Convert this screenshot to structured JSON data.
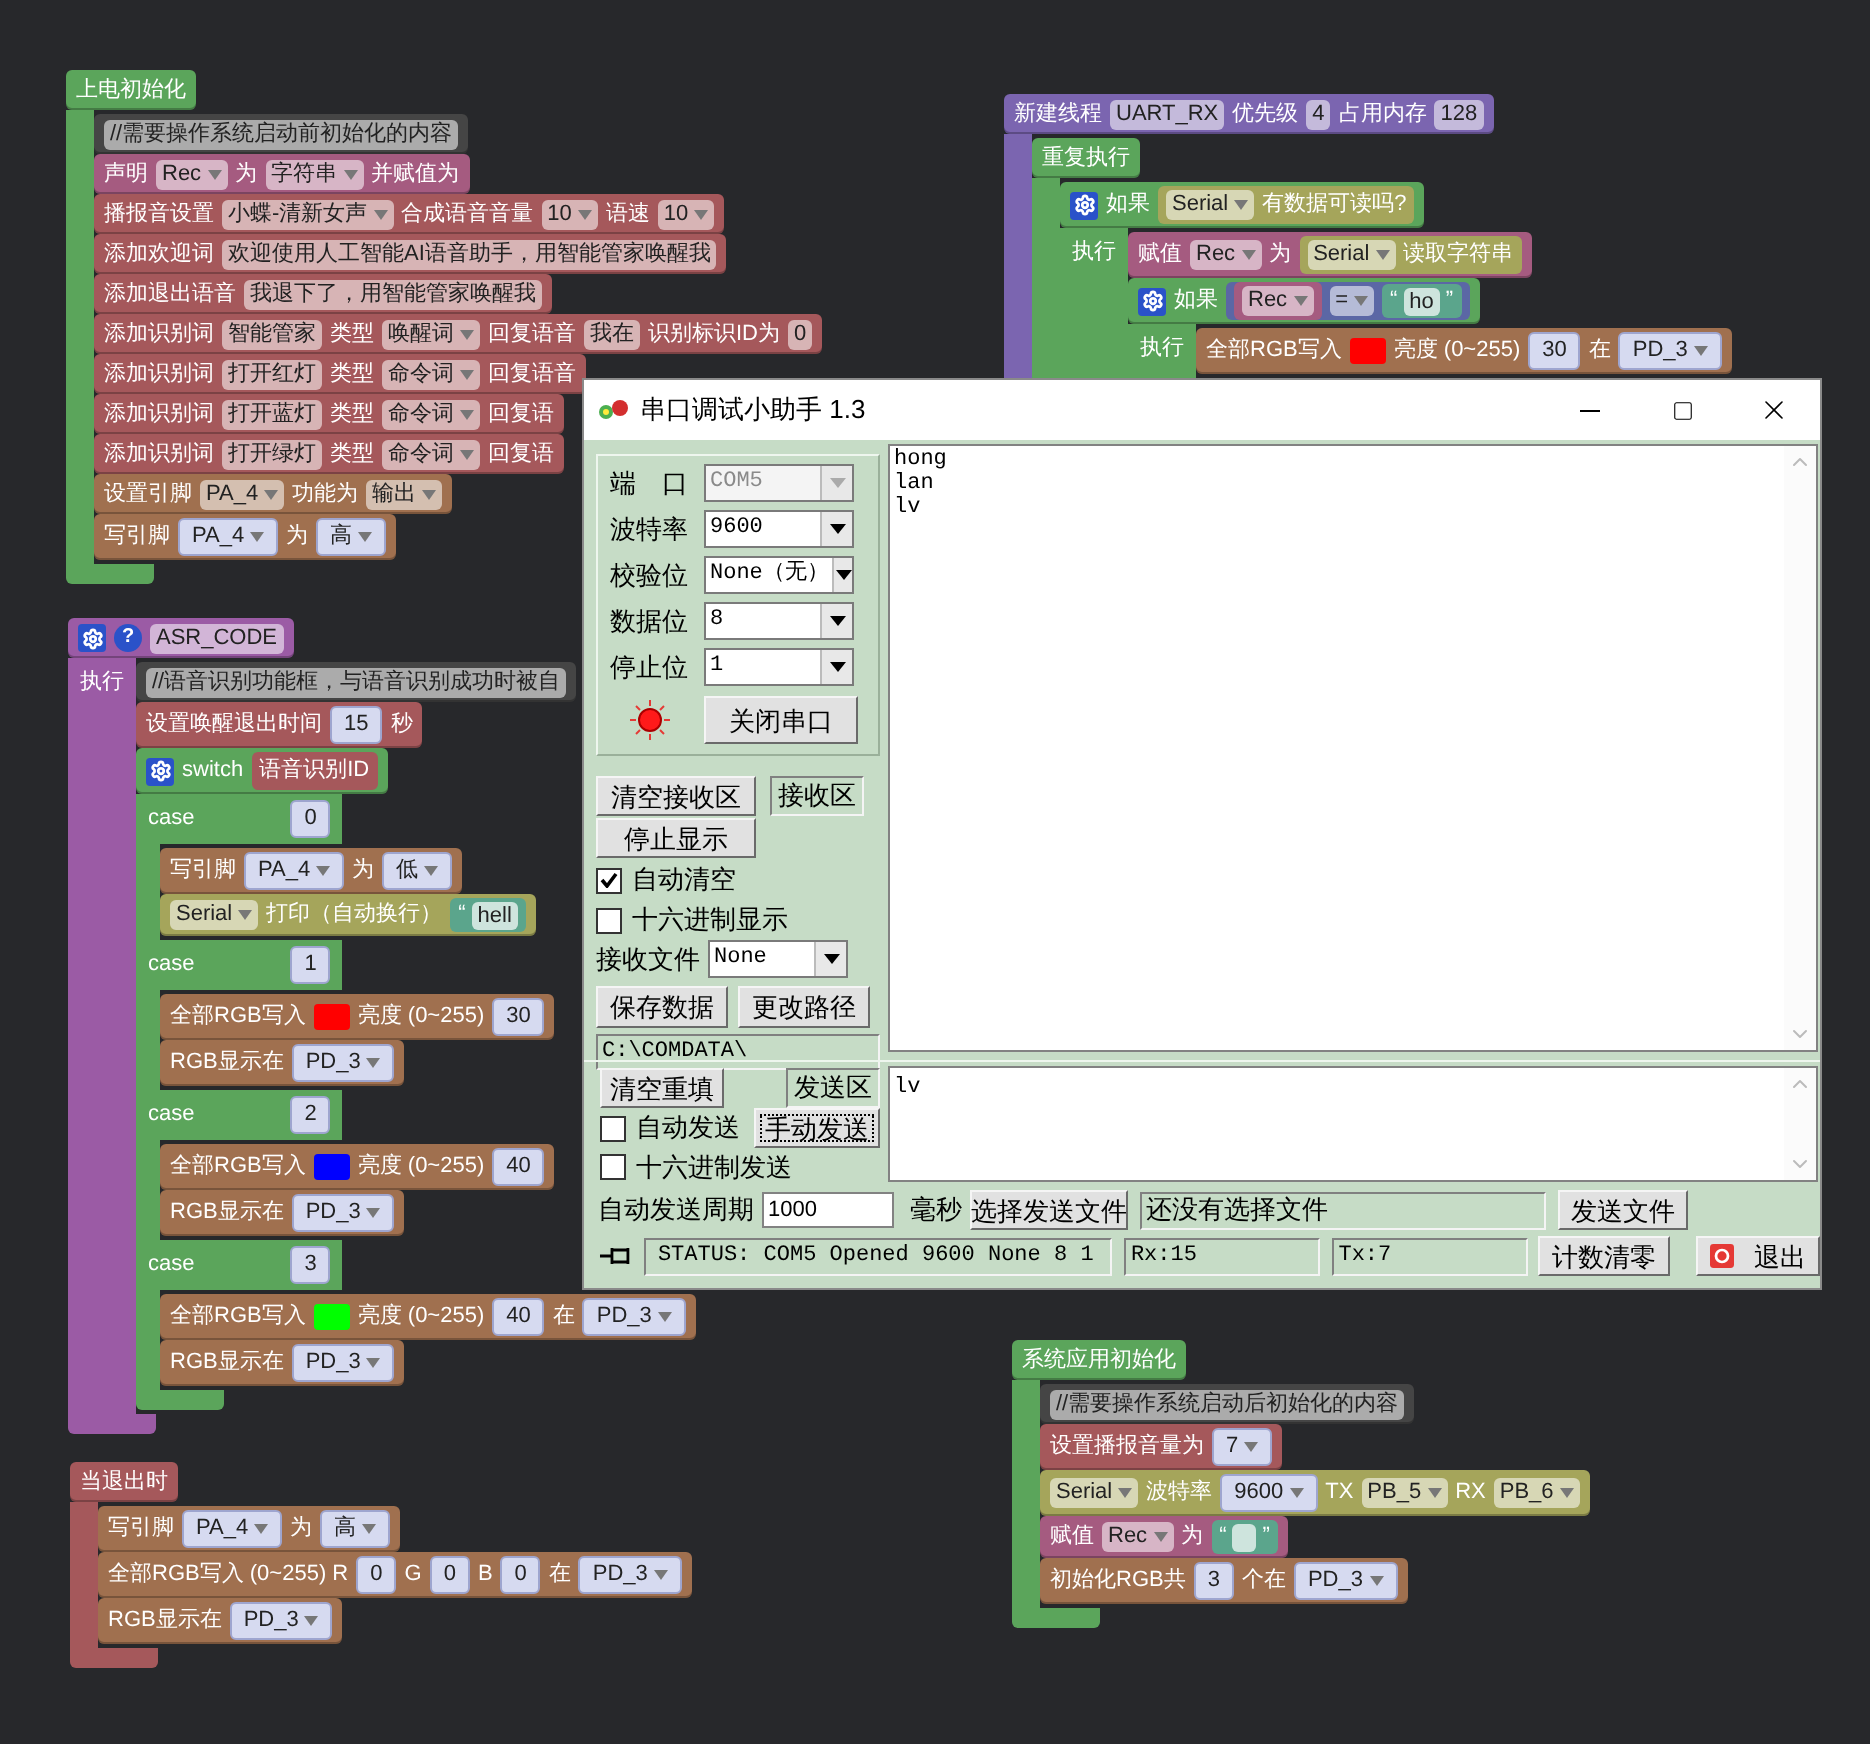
{
  "stacks": [
    {
      "color": "#5ba55b",
      "parts": [
        {
          "kind": "text",
          "text": "上电初始化"
        }
      ],
      "inputs": [
        {
          "children": [
            {
              "color": "#454545",
              "parts": [
                {
                  "kind": "field",
                  "text": "//需要操作系统启动前初始化的内容"
                }
              ]
            },
            {
              "color": "#a55b80",
              "parts": [
                {
                  "kind": "text",
                  "text": "声明"
                },
                {
                  "kind": "field",
                  "text": "Rec",
                  "dropdown": true
                },
                {
                  "kind": "text",
                  "text": "为"
                },
                {
                  "kind": "field",
                  "text": "字符串",
                  "dropdown": true
                },
                {
                  "kind": "text",
                  "text": "并赋值为"
                }
              ]
            },
            {
              "color": "#a5585b",
              "parts": [
                {
                  "kind": "text",
                  "text": "播报音设置"
                },
                {
                  "kind": "field",
                  "text": "小蝶-清新女声",
                  "dropdown": true
                },
                {
                  "kind": "text",
                  "text": "合成语音音量"
                },
                {
                  "kind": "field",
                  "text": "10",
                  "dropdown": true
                },
                {
                  "kind": "text",
                  "text": "语速"
                },
                {
                  "kind": "field",
                  "text": "10",
                  "dropdown": true
                }
              ]
            },
            {
              "color": "#a5585b",
              "parts": [
                {
                  "kind": "text",
                  "text": "添加欢迎词"
                },
                {
                  "kind": "field",
                  "text": "欢迎使用人工智能AI语音助手，用智能管家唤醒我"
                }
              ]
            },
            {
              "color": "#a5585b",
              "parts": [
                {
                  "kind": "text",
                  "text": "添加退出语音"
                },
                {
                  "kind": "field",
                  "text": "我退下了，用智能管家唤醒我"
                }
              ]
            },
            {
              "color": "#a5585b",
              "parts": [
                {
                  "kind": "text",
                  "text": "添加识别词"
                },
                {
                  "kind": "field",
                  "text": "智能管家"
                },
                {
                  "kind": "text",
                  "text": "类型"
                },
                {
                  "kind": "field",
                  "text": "唤醒词",
                  "dropdown": true
                },
                {
                  "kind": "text",
                  "text": "回复语音"
                },
                {
                  "kind": "field",
                  "text": "我在"
                },
                {
                  "kind": "text",
                  "text": "识别标识ID为"
                },
                {
                  "kind": "field",
                  "text": "0"
                }
              ]
            },
            {
              "color": "#a5585b",
              "parts": [
                {
                  "kind": "text",
                  "text": "添加识别词"
                },
                {
                  "kind": "field",
                  "text": "打开红灯"
                },
                {
                  "kind": "text",
                  "text": "类型"
                },
                {
                  "kind": "field",
                  "text": "命令词",
                  "dropdown": true
                },
                {
                  "kind": "text",
                  "text": "回复语音"
                }
              ]
            },
            {
              "color": "#a5585b",
              "parts": [
                {
                  "kind": "text",
                  "text": "添加识别词"
                },
                {
                  "kind": "field",
                  "text": "打开蓝灯"
                },
                {
                  "kind": "text",
                  "text": "类型"
                },
                {
                  "kind": "field",
                  "text": "命令词",
                  "dropdown": true
                },
                {
                  "kind": "text",
                  "text": "回复语"
                }
              ]
            },
            {
              "color": "#a5585b",
              "parts": [
                {
                  "kind": "text",
                  "text": "添加识别词"
                },
                {
                  "kind": "field",
                  "text": "打开绿灯"
                },
                {
                  "kind": "text",
                  "text": "类型"
                },
                {
                  "kind": "field",
                  "text": "命令词",
                  "dropdown": true
                },
                {
                  "kind": "text",
                  "text": "回复语"
                }
              ]
            },
            {
              "color": "#a0704f",
              "parts": [
                {
                  "kind": "text",
                  "text": "设置引脚"
                },
                {
                  "kind": "field",
                  "text": "PA_4",
                  "dropdown": true
                },
                {
                  "kind": "text",
                  "text": "功能为"
                },
                {
                  "kind": "field",
                  "text": "输出",
                  "dropdown": true
                }
              ]
            },
            {
              "color": "#a0704f",
              "parts": [
                {
                  "kind": "text",
                  "text": "写引脚"
                },
                {
                  "kind": "input",
                  "text": "PA_4",
                  "dropdown": true
                },
                {
                  "kind": "text",
                  "text": "为"
                },
                {
                  "kind": "input",
                  "text": "高",
                  "dropdown": true
                }
              ]
            }
          ]
        }
      ]
    },
    {
      "color": "#9b5ba5",
      "parts": [
        {
          "kind": "mutator"
        },
        {
          "kind": "help",
          "text": "?"
        },
        {
          "kind": "field",
          "text": "ASR_CODE"
        }
      ],
      "inputs": [
        {
          "label": "执行",
          "children": [
            {
              "color": "#454545",
              "parts": [
                {
                  "kind": "field",
                  "text": "//语音识别功能框，与语音识别成功时被自"
                }
              ]
            },
            {
              "color": "#a5585b",
              "parts": [
                {
                  "kind": "text",
                  "text": "设置唤醒退出时间"
                },
                {
                  "kind": "input",
                  "text": "15"
                },
                {
                  "kind": "text",
                  "text": "秒"
                }
              ]
            },
            {
              "color": "#5ba55b",
              "parts": [
                {
                  "kind": "mutator"
                },
                {
                  "kind": "text",
                  "text": "switch"
                },
                {
                  "kind": "block",
                  "color": "#a5585b",
                  "parts": [
                    {
                      "kind": "text",
                      "text": "语音识别ID"
                    }
                  ]
                }
              ],
              "inputs": [
                {
                  "label": "case",
                  "parts": [
                    {
                      "kind": "input",
                      "text": "0"
                    }
                  ],
                  "children": [
                    {
                      "color": "#a0704f",
                      "parts": [
                        {
                          "kind": "text",
                          "text": "写引脚"
                        },
                        {
                          "kind": "input",
                          "text": "PA_4",
                          "dropdown": true
                        },
                        {
                          "kind": "text",
                          "text": "为"
                        },
                        {
                          "kind": "input",
                          "text": "低",
                          "dropdown": true
                        }
                      ]
                    },
                    {
                      "color": "#a5a55b",
                      "parts": [
                        {
                          "kind": "field",
                          "text": "Serial",
                          "dropdown": true
                        },
                        {
                          "kind": "text",
                          "text": "打印（自动换行）"
                        },
                        {
                          "kind": "string",
                          "open": "“",
                          "text": "hell"
                        }
                      ]
                    }
                  ]
                },
                {
                  "label": "case",
                  "parts": [
                    {
                      "kind": "input",
                      "text": "1"
                    }
                  ],
                  "children": [
                    {
                      "color": "#a0704f",
                      "parts": [
                        {
                          "kind": "text",
                          "text": "全部RGB写入"
                        },
                        {
                          "kind": "swatch",
                          "color": "#ff0000"
                        },
                        {
                          "kind": "text",
                          "text": "亮度 (0~255)"
                        },
                        {
                          "kind": "input",
                          "text": "30"
                        }
                      ]
                    },
                    {
                      "color": "#a0704f",
                      "parts": [
                        {
                          "kind": "text",
                          "text": "RGB显示在"
                        },
                        {
                          "kind": "input",
                          "text": "PD_3",
                          "dropdown": true
                        }
                      ]
                    }
                  ]
                },
                {
                  "label": "case",
                  "parts": [
                    {
                      "kind": "input",
                      "text": "2"
                    }
                  ],
                  "children": [
                    {
                      "color": "#a0704f",
                      "parts": [
                        {
                          "kind": "text",
                          "text": "全部RGB写入"
                        },
                        {
                          "kind": "swatch",
                          "color": "#0000ff"
                        },
                        {
                          "kind": "text",
                          "text": "亮度 (0~255)"
                        },
                        {
                          "kind": "input",
                          "text": "40"
                        }
                      ]
                    },
                    {
                      "color": "#a0704f",
                      "parts": [
                        {
                          "kind": "text",
                          "text": "RGB显示在"
                        },
                        {
                          "kind": "input",
                          "text": "PD_3",
                          "dropdown": true
                        }
                      ]
                    }
                  ]
                },
                {
                  "label": "case",
                  "parts": [
                    {
                      "kind": "input",
                      "text": "3"
                    }
                  ],
                  "children": [
                    {
                      "color": "#a0704f",
                      "parts": [
                        {
                          "kind": "text",
                          "text": "全部RGB写入"
                        },
                        {
                          "kind": "swatch",
                          "color": "#00ff00"
                        },
                        {
                          "kind": "text",
                          "text": "亮度 (0~255)"
                        },
                        {
                          "kind": "input",
                          "text": "40"
                        },
                        {
                          "kind": "text",
                          "text": "在"
                        },
                        {
                          "kind": "input",
                          "text": "PD_3",
                          "dropdown": true
                        }
                      ]
                    },
                    {
                      "color": "#a0704f",
                      "parts": [
                        {
                          "kind": "text",
                          "text": "RGB显示在"
                        },
                        {
                          "kind": "input",
                          "text": "PD_3",
                          "dropdown": true
                        }
                      ]
                    }
                  ]
                }
              ]
            }
          ]
        }
      ]
    },
    {
      "color": "#a5585b",
      "parts": [
        {
          "kind": "text",
          "text": "当退出时"
        }
      ],
      "inputs": [
        {
          "children": [
            {
              "color": "#a0704f",
              "parts": [
                {
                  "kind": "text",
                  "text": "写引脚"
                },
                {
                  "kind": "input",
                  "text": "PA_4",
                  "dropdown": true
                },
                {
                  "kind": "text",
                  "text": "为"
                },
                {
                  "kind": "input",
                  "text": "高",
                  "dropdown": true
                }
              ]
            },
            {
              "color": "#a0704f",
              "parts": [
                {
                  "kind": "text",
                  "text": "全部RGB写入 (0~255) R"
                },
                {
                  "kind": "input",
                  "text": "0"
                },
                {
                  "kind": "text",
                  "text": "G"
                },
                {
                  "kind": "input",
                  "text": "0"
                },
                {
                  "kind": "text",
                  "text": "B"
                },
                {
                  "kind": "input",
                  "text": "0"
                },
                {
                  "kind": "text",
                  "text": "在"
                },
                {
                  "kind": "input",
                  "text": "PD_3",
                  "dropdown": true
                }
              ]
            },
            {
              "color": "#a0704f",
              "parts": [
                {
                  "kind": "text",
                  "text": "RGB显示在"
                },
                {
                  "kind": "input",
                  "text": "PD_3",
                  "dropdown": true
                }
              ]
            }
          ]
        }
      ]
    },
    {
      "color": "#7b65b0",
      "parts": [
        {
          "kind": "text",
          "text": "新建线程"
        },
        {
          "kind": "field",
          "text": "UART_RX"
        },
        {
          "kind": "text",
          "text": "优先级"
        },
        {
          "kind": "field",
          "text": "4"
        },
        {
          "kind": "text",
          "text": "占用内存"
        },
        {
          "kind": "field",
          "text": "128"
        }
      ],
      "inputs": [
        {
          "children": [
            {
              "color": "#5ba55b",
              "parts": [
                {
                  "kind": "text",
                  "text": "重复执行"
                }
              ],
              "inputs": [
                {
                  "children": [
                    {
                      "color": "#5ba55b",
                      "parts": [
                        {
                          "kind": "mutator"
                        },
                        {
                          "kind": "text",
                          "text": "如果"
                        },
                        {
                          "kind": "block",
                          "color": "#a5a55b",
                          "parts": [
                            {
                              "kind": "field",
                              "text": "Serial",
                              "dropdown": true
                            },
                            {
                              "kind": "text",
                              "text": "有数据可读吗?"
                            }
                          ]
                        }
                      ],
                      "inputs": [
                        {
                          "label": "执行",
                          "children": [
                            {
                              "color": "#a55b80",
                              "parts": [
                                {
                                  "kind": "text",
                                  "text": "赋值"
                                },
                                {
                                  "kind": "field",
                                  "text": "Rec",
                                  "dropdown": true
                                },
                                {
                                  "kind": "text",
                                  "text": "为"
                                },
                                {
                                  "kind": "block",
                                  "color": "#a5a55b",
                                  "parts": [
                                    {
                                      "kind": "field",
                                      "text": "Serial",
                                      "dropdown": true
                                    },
                                    {
                                      "kind": "text",
                                      "text": "读取字符串"
                                    }
                                  ]
                                }
                              ]
                            },
                            {
                              "color": "#5ba55b",
                              "parts": [
                                {
                                  "kind": "mutator"
                                },
                                {
                                  "kind": "text",
                                  "text": "如果"
                                },
                                {
                                  "kind": "block",
                                  "color": "#5b67a5",
                                  "parts": [
                                    {
                                      "kind": "block",
                                      "color": "#a55b80",
                                      "parts": [
                                        {
                                          "kind": "field",
                                          "text": "Rec",
                                          "dropdown": true
                                        }
                                      ]
                                    },
                                    {
                                      "kind": "field",
                                      "text": "=",
                                      "dropdown": true
                                    },
                                    {
                                      "kind": "string",
                                      "open": "“",
                                      "text": "ho",
                                      "close": "”"
                                    }
                                  ]
                                }
                              ],
                              "inputs": [
                                {
                                  "label": "执行",
                                  "children": [
                                    {
                                      "color": "#a0704f",
                                      "parts": [
                                        {
                                          "kind": "text",
                                          "text": "全部RGB写入"
                                        },
                                        {
                                          "kind": "swatch",
                                          "color": "#ff0000"
                                        },
                                        {
                                          "kind": "text",
                                          "text": "亮度 (0~255)"
                                        },
                                        {
                                          "kind": "input",
                                          "text": "30"
                                        },
                                        {
                                          "kind": "text",
                                          "text": "在"
                                        },
                                        {
                                          "kind": "input",
                                          "text": "PD_3",
                                          "dropdown": true
                                        }
                                      ]
                                    }
                                  ]
                                }
                              ]
                            }
                          ]
                        }
                      ]
                    }
                  ]
                }
              ]
            }
          ]
        }
      ]
    },
    {
      "color": "#5ba55b",
      "parts": [
        {
          "kind": "text",
          "text": "系统应用初始化"
        }
      ],
      "inputs": [
        {
          "children": [
            {
              "color": "#454545",
              "parts": [
                {
                  "kind": "field",
                  "text": "//需要操作系统启动后初始化的内容"
                }
              ]
            },
            {
              "color": "#a5585b",
              "parts": [
                {
                  "kind": "text",
                  "text": "设置播报音量为"
                },
                {
                  "kind": "input",
                  "text": "7",
                  "dropdown": true
                }
              ]
            },
            {
              "color": "#a5a55b",
              "parts": [
                {
                  "kind": "field",
                  "text": "Serial",
                  "dropdown": true
                },
                {
                  "kind": "text",
                  "text": "波特率"
                },
                {
                  "kind": "input",
                  "text": "9600",
                  "dropdown": true
                },
                {
                  "kind": "text",
                  "text": "TX"
                },
                {
                  "kind": "field",
                  "text": "PB_5",
                  "dropdown": true
                },
                {
                  "kind": "text",
                  "text": "RX"
                },
                {
                  "kind": "field",
                  "text": "PB_6",
                  "dropdown": true
                }
              ]
            },
            {
              "color": "#a55b80",
              "parts": [
                {
                  "kind": "text",
                  "text": "赋值"
                },
                {
                  "kind": "field",
                  "text": "Rec",
                  "dropdown": true
                },
                {
                  "kind": "text",
                  "text": "为"
                },
                {
                  "kind": "string",
                  "open": "“",
                  "close": "”"
                }
              ]
            },
            {
              "color": "#a0704f",
              "parts": [
                {
                  "kind": "text",
                  "text": "初始化RGB共"
                },
                {
                  "kind": "input",
                  "text": "3"
                },
                {
                  "kind": "text",
                  "text": "个在"
                },
                {
                  "kind": "input",
                  "text": "PD_3",
                  "dropdown": true
                }
              ]
            }
          ]
        }
      ]
    }
  ],
  "serial_window": {
    "title": "串口调试小助手 1.3",
    "settings": [
      {
        "label": "端　口",
        "value": "COM5",
        "disabled": true
      },
      {
        "label": "波特率",
        "value": "9600",
        "disabled": false
      },
      {
        "label": "校验位",
        "value": "None（无）",
        "disabled": false
      },
      {
        "label": "数据位",
        "value": "8",
        "disabled": false
      },
      {
        "label": "停止位",
        "value": "1",
        "disabled": false
      }
    ],
    "port_button": "关闭串口",
    "clear_receive": "清空接收区",
    "receive_area_label": "接收区",
    "stop_display": "停止显示",
    "auto_clear": {
      "label": "自动清空",
      "checked": true
    },
    "hex_display": {
      "label": "十六进制显示",
      "checked": false
    },
    "receive_file": {
      "label": "接收文件",
      "value": "None"
    },
    "save_data": "保存数据",
    "change_path": "更改路径",
    "path": "C:\\COMDATA\\",
    "received_lines": [
      "hong",
      "lan",
      "lv"
    ],
    "clear_refill": "清空重填",
    "send_area_label": "发送区",
    "auto_send": {
      "label": "自动发送",
      "checked": false
    },
    "manual_send": "手动发送",
    "hex_send": {
      "label": "十六进制发送",
      "checked": false
    },
    "send_text": "lv",
    "period_label": "自动发送周期",
    "period": "1000",
    "ms": "毫秒",
    "choose_file": "选择发送文件",
    "file_status": "还没有选择文件",
    "send_file": "发送文件",
    "status": "STATUS: COM5 Opened 9600 None  8 1",
    "rx": "Rx:15",
    "tx": "Tx:7",
    "reset_count": "计数清零",
    "exit": "退出"
  }
}
